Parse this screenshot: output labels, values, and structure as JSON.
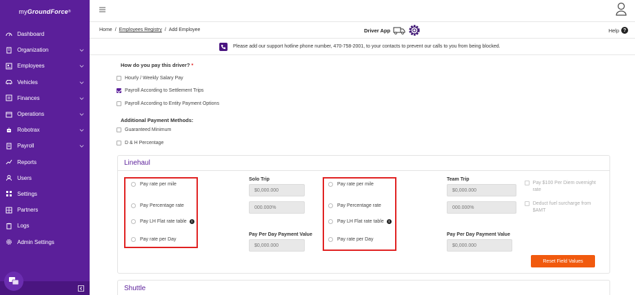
{
  "app": {
    "logo_prefix": "my",
    "logo_brand": "GroundForce",
    "logo_mark": "®"
  },
  "sidebar": {
    "items": [
      {
        "label": "Dashboard",
        "icon": "dashboard-icon",
        "has_children": false
      },
      {
        "label": "Organization",
        "icon": "building-icon",
        "has_children": true
      },
      {
        "label": "Employees",
        "icon": "id-card-icon",
        "has_children": true
      },
      {
        "label": "Vehicles",
        "icon": "car-icon",
        "has_children": true
      },
      {
        "label": "Finances",
        "icon": "finance-icon",
        "has_children": true
      },
      {
        "label": "Operations",
        "icon": "calendar-icon",
        "has_children": true
      },
      {
        "label": "Robotrax",
        "icon": "robot-icon",
        "has_children": true
      },
      {
        "label": "Payroll",
        "icon": "payroll-icon",
        "has_children": true
      },
      {
        "label": "Reports",
        "icon": "chart-icon",
        "has_children": false
      },
      {
        "label": "Users",
        "icon": "users-icon",
        "has_children": false
      },
      {
        "label": "Settings",
        "icon": "settings-icon",
        "has_children": false
      },
      {
        "label": "Partners",
        "icon": "partners-icon",
        "has_children": false
      },
      {
        "label": "Logs",
        "icon": "clipboard-icon",
        "has_children": false
      },
      {
        "label": "Admin Settings",
        "icon": "gear-icon",
        "has_children": false
      }
    ]
  },
  "breadcrumb": {
    "home": "Home",
    "registry": "Employees Registry",
    "current": "Add Employee",
    "sep": "/"
  },
  "header": {
    "driver_app": "Driver App",
    "help": "Help",
    "help_mark": "?"
  },
  "notice": {
    "text": "Please add our support hotline phone number, 470-758-2001, to your contacts to prevent our calls to you from being blocked."
  },
  "payment": {
    "question": "How do you pay this driver?",
    "required_mark": "*",
    "options": [
      {
        "label": "Hourly / Weekly Salary Pay",
        "checked": false
      },
      {
        "label": "Payroll According to Settlement Trips",
        "checked": true
      },
      {
        "label": "Payroll According to Entity Payment Options",
        "checked": false
      }
    ],
    "additional_title": "Additional Payment Methods:",
    "additional": [
      {
        "label": "Guaranteed Minimum",
        "checked": false
      },
      {
        "label": "D & H Percentage",
        "checked": false
      }
    ]
  },
  "linehaul": {
    "title": "Linehaul",
    "radio_options": [
      "Pay rate per mile",
      "Pay Percentage rate",
      "Pay LH Flat rate table",
      "Pay rate per Day"
    ],
    "info_mark": "i",
    "solo": {
      "label": "Solo Trip",
      "rate_placeholder": "$0,000.000",
      "percent_placeholder": "000.000%",
      "per_day_label": "Pay Per Day Payment Value",
      "per_day_placeholder": "$0,000.000"
    },
    "team": {
      "label": "Team Trip",
      "rate_placeholder": "$0,000.000",
      "percent_placeholder": "000.000%",
      "per_day_label": "Pay Per Day Payment Value",
      "per_day_placeholder": "$0,000.000"
    },
    "side_options": [
      "Pay $100 Per Diem overnight rate",
      "Deduct fuel surcharge from $AMT"
    ],
    "reset_label": "Reset Field Values"
  },
  "shuttle": {
    "title": "Shuttle"
  },
  "colors": {
    "sidebar": "#5b1f9a",
    "accent": "#f15a0e",
    "highlight_border": "#e02020"
  }
}
